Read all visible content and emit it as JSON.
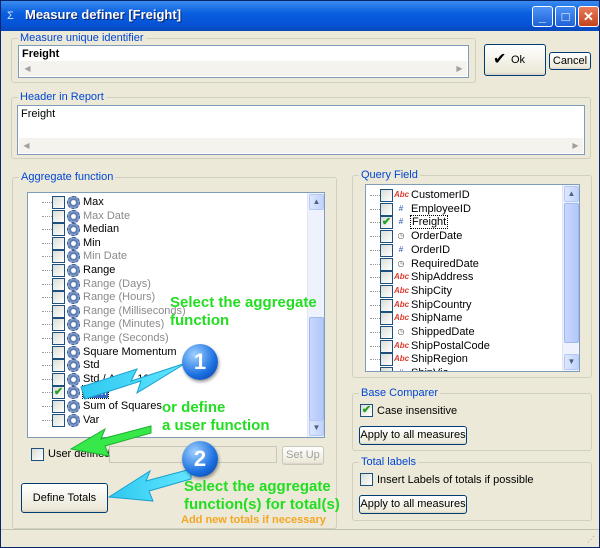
{
  "window": {
    "title": "Measure definer [Freight]",
    "minimize": "_",
    "maximize": "□",
    "close": "✕"
  },
  "measure_id": {
    "label": "Measure unique identifier",
    "value": "Freight"
  },
  "buttons": {
    "ok": "Ok",
    "ok_check": "✔",
    "cancel": "Cancel",
    "setup": "Set Up",
    "define_totals": "Define Totals",
    "apply_case": "Apply to all measures",
    "apply_totals": "Apply to all measures"
  },
  "header": {
    "label": "Header in Report",
    "value": "Freight"
  },
  "aggregate": {
    "label": "Aggregate function",
    "items": [
      {
        "label": "Max",
        "checked": false,
        "dim": false
      },
      {
        "label": "Max Date",
        "checked": false,
        "dim": true
      },
      {
        "label": "Median",
        "checked": false,
        "dim": false
      },
      {
        "label": "Min",
        "checked": false,
        "dim": false
      },
      {
        "label": "Min Date",
        "checked": false,
        "dim": true
      },
      {
        "label": "Range",
        "checked": false,
        "dim": false
      },
      {
        "label": "Range (Days)",
        "checked": false,
        "dim": true
      },
      {
        "label": "Range (Hours)",
        "checked": false,
        "dim": true
      },
      {
        "label": "Range (Milliseconds)",
        "checked": false,
        "dim": true
      },
      {
        "label": "Range (Minutes)",
        "checked": false,
        "dim": true
      },
      {
        "label": "Range (Seconds)",
        "checked": false,
        "dim": true
      },
      {
        "label": "Square Momentum",
        "checked": false,
        "dim": false
      },
      {
        "label": "Std",
        "checked": false,
        "dim": false
      },
      {
        "label": "Std / Avg * 100",
        "checked": false,
        "dim": false
      },
      {
        "label": "Sum",
        "checked": true,
        "dim": false,
        "selected": true
      },
      {
        "label": "Sum of Squares",
        "checked": false,
        "dim": false
      },
      {
        "label": "Var",
        "checked": false,
        "dim": false
      }
    ],
    "user_defined_label": "User defined"
  },
  "query_field": {
    "label": "Query Field",
    "items": [
      {
        "label": "CustomerID",
        "type": "abc",
        "checked": false
      },
      {
        "label": "EmployeeID",
        "type": "num",
        "checked": false
      },
      {
        "label": "Freight",
        "type": "num",
        "checked": true,
        "selected": true
      },
      {
        "label": "OrderDate",
        "type": "date",
        "checked": false
      },
      {
        "label": "OrderID",
        "type": "num",
        "checked": false
      },
      {
        "label": "RequiredDate",
        "type": "date",
        "checked": false
      },
      {
        "label": "ShipAddress",
        "type": "abc",
        "checked": false
      },
      {
        "label": "ShipCity",
        "type": "abc",
        "checked": false
      },
      {
        "label": "ShipCountry",
        "type": "abc",
        "checked": false
      },
      {
        "label": "ShipName",
        "type": "abc",
        "checked": false
      },
      {
        "label": "ShippedDate",
        "type": "date",
        "checked": false
      },
      {
        "label": "ShipPostalCode",
        "type": "abc",
        "checked": false
      },
      {
        "label": "ShipRegion",
        "type": "abc",
        "checked": false
      },
      {
        "label": "ShipVia",
        "type": "num",
        "checked": false
      }
    ]
  },
  "base_comparer": {
    "label": "Base Comparer",
    "case_insensitive": "Case insensitive"
  },
  "total_labels": {
    "label": "Total labels",
    "insert_labels": "Insert Labels of totals if possible"
  },
  "annotations": {
    "select_line1": "Select the aggregate",
    "select_line2": "function",
    "or_line1": "or define",
    "or_line2": "a user function",
    "totals_line1": "Select the aggregate",
    "totals_line2": "function(s) for total(s)",
    "add_totals": "Add new totals if necessary",
    "badge1": "1",
    "badge2": "2"
  },
  "type_icons": {
    "abc": "Abc",
    "num": "#",
    "date": "◷"
  },
  "colors": {
    "annotation_green": "#22dd22",
    "annotation_orange": "#f5a623",
    "arrow_cyan": "#2ec8f0",
    "groupbox_label": "#0046d5"
  }
}
